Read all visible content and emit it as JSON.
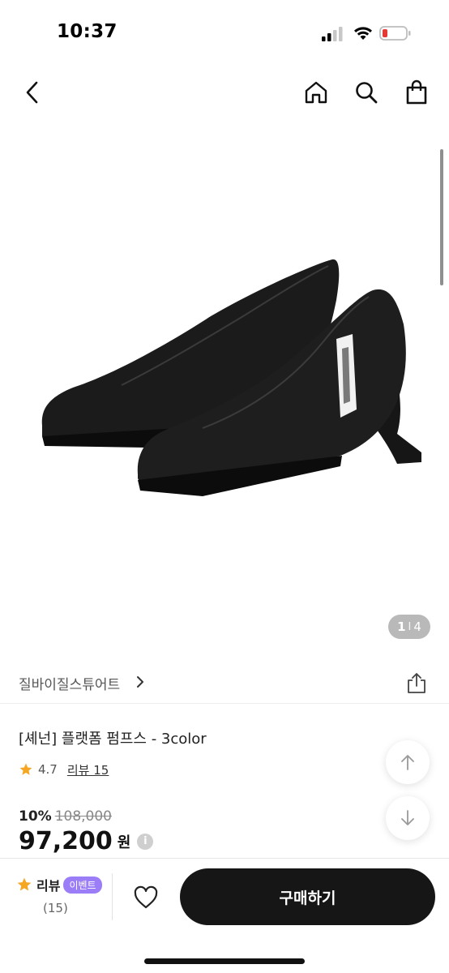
{
  "status_bar": {
    "time": "10:37",
    "battery_color": "#e53935"
  },
  "nav": {
    "back_icon": "chevron-left-icon",
    "home_icon": "home-icon",
    "search_icon": "search-icon",
    "cart_icon": "shopping-bag-icon"
  },
  "gallery": {
    "current": "1",
    "total": "4",
    "separator": "I"
  },
  "brand": {
    "name": "질바이질스튜어트"
  },
  "product": {
    "title": "[셰넌] 플랫폼 펌프스 - 3color",
    "rating": "4.7",
    "review_link": "리뷰 15",
    "discount": "10%",
    "original_price": "108,000",
    "price": "97,200",
    "currency": "원",
    "info_symbol": "i"
  },
  "bottom_bar": {
    "review_label": "리뷰",
    "event_badge": "이벤트",
    "review_count": "(15)",
    "buy_label": "구매하기",
    "accent_star_color": "#f5a623",
    "badge_color": "#9b7df7"
  }
}
